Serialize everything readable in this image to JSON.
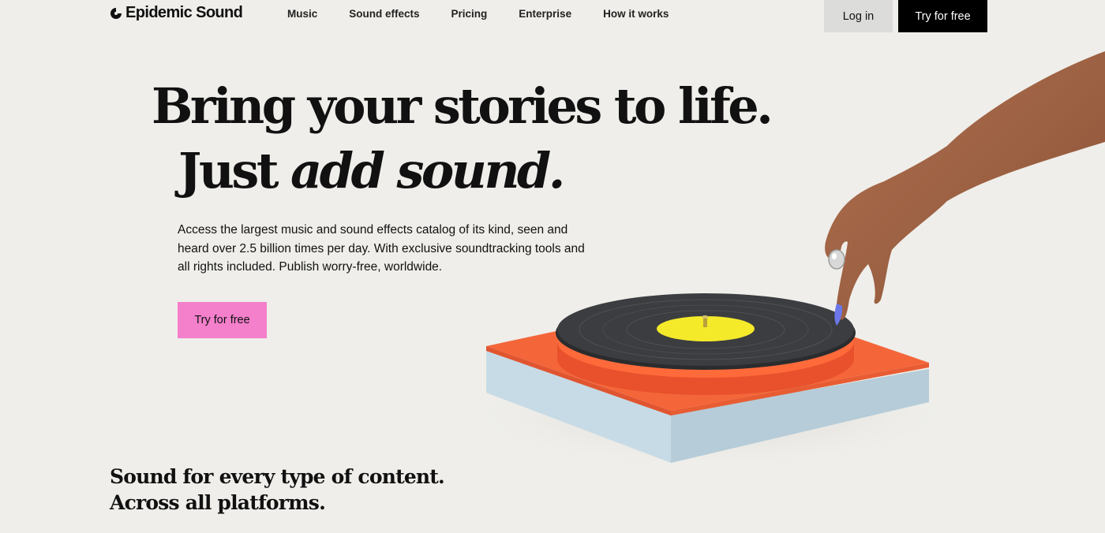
{
  "header": {
    "logo_text": "Epidemic Sound",
    "nav": [
      "Music",
      "Sound effects",
      "Pricing",
      "Enterprise",
      "How it works"
    ],
    "login_label": "Log in",
    "try_label": "Try for free"
  },
  "hero": {
    "headline_line1": "Bring your stories to life.",
    "headline_line2_plain": "Just ",
    "headline_line2_italic": "add sound.",
    "body": "Access the largest music and sound effects catalog of its kind, seen and heard over 2.5 billion times per day. With exclusive soundtracking tools and all rights included. Publish worry-free, worldwide.",
    "cta_label": "Try for free"
  },
  "section": {
    "heading_line1": "Sound for every type of content.",
    "heading_line2": "Across all platforms."
  },
  "colors": {
    "background": "#efeeea",
    "hero_cta": "#f47fcb",
    "top_cta": "#000000",
    "login_bg": "#dcdcda"
  },
  "icons": {
    "logo": "epidemic-sound-logo-icon"
  }
}
